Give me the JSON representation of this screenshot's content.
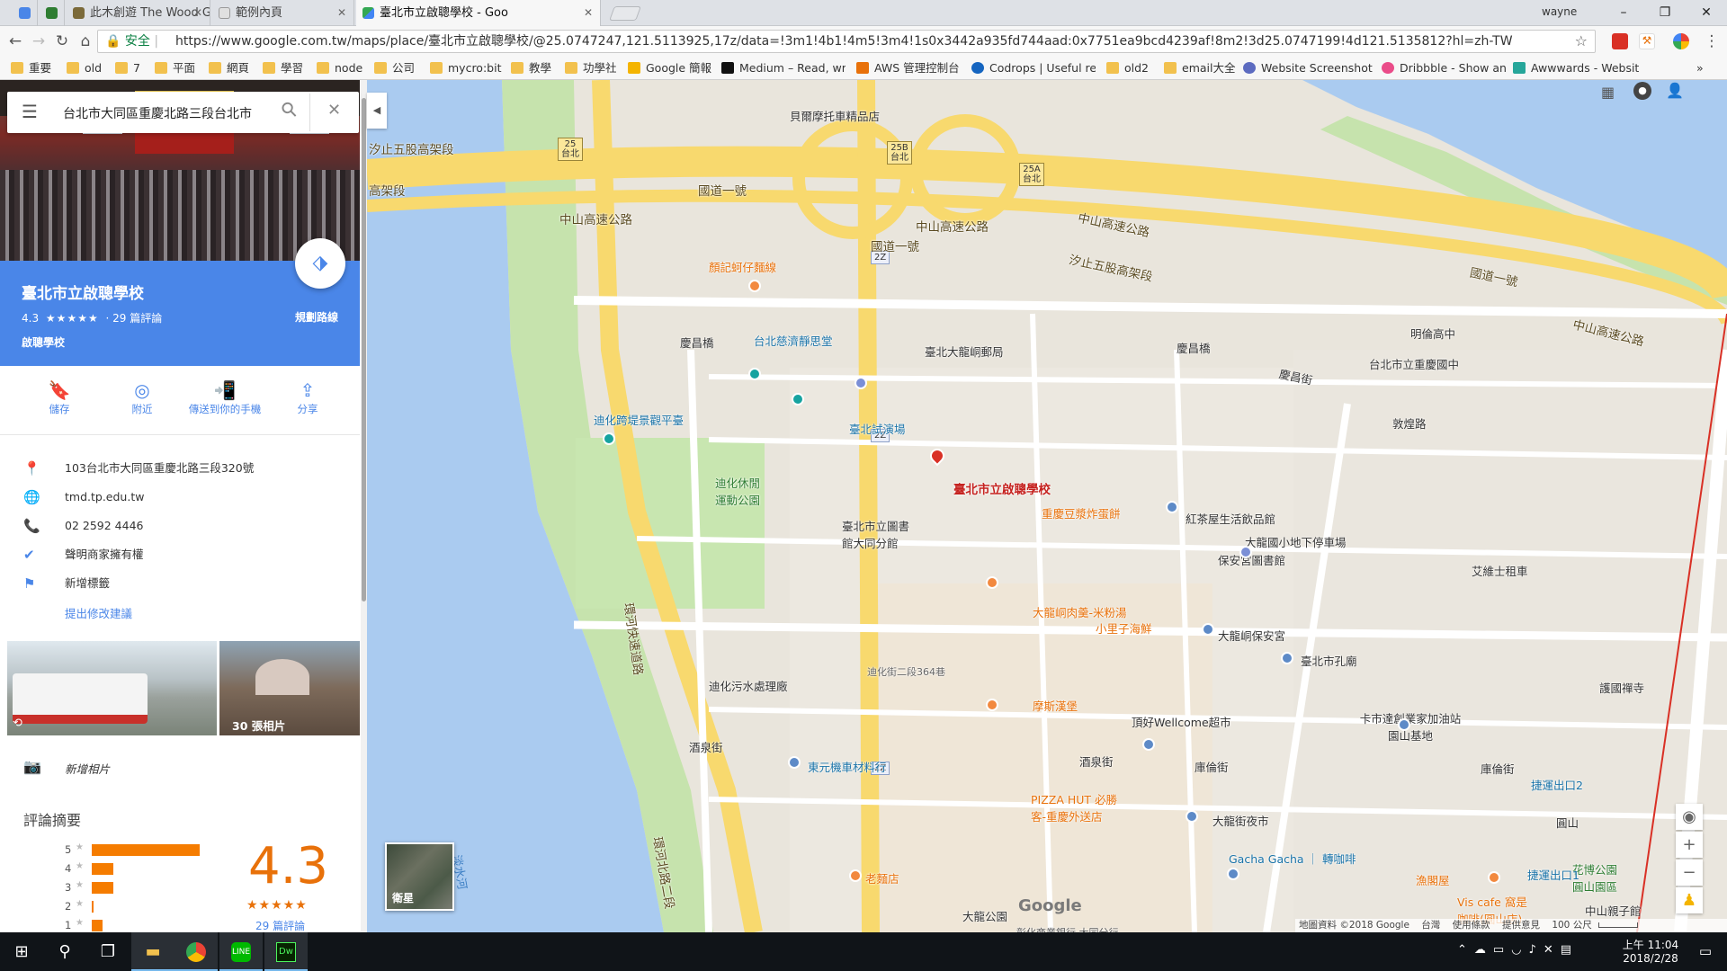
{
  "tabs": [
    {
      "title": "",
      "icon_color": "#4a86e8"
    },
    {
      "title": "",
      "icon_color": "#2e7d32"
    },
    {
      "title": "此木創遊 The Wood Ga",
      "icon_color": "#7b6a3a"
    },
    {
      "title": "範例內頁",
      "icon_color": "#9e9e9e"
    },
    {
      "title": "臺北市立啟聰學校 - Goo",
      "icon_color": "#34a853",
      "active": true
    }
  ],
  "window": {
    "user": "wayne",
    "minimize": "–",
    "maximize": "❐",
    "close": "✕"
  },
  "toolbar": {
    "back": "←",
    "forward": "→",
    "reload": "↻",
    "home": "⌂",
    "secure_label": "安全",
    "url": "https://www.google.com.tw/maps/place/臺北市立啟聰學校/@25.0747247,121.5113925,17z/data=!3m1!4b1!4m5!3m4!1s0x3442a935fd744aad:0x7751ea9bcd4239af!8m2!3d25.0747199!4d121.5135812?hl=zh-TW",
    "bookmark_star": "☆",
    "menu": "⋮"
  },
  "bookmarks": [
    "重要",
    "old",
    "7",
    "平面",
    "網頁",
    "學習",
    "node",
    "公司",
    "mycro:bit",
    "教學",
    "功學社",
    "Google 簡報",
    "Medium – Read, wri",
    "AWS 管理控制台",
    "Codrops | Useful res",
    "old2",
    "email大全",
    "Website Screenshot",
    "Dribbble - Show and",
    "Awwwards - Websit"
  ],
  "bookmarks_more": "»",
  "sidebar": {
    "search_value": "台北市大同區重慶北路三段台北市",
    "menu_icon": "☰",
    "search_icon": "⚲",
    "clear_icon": "✕",
    "place_name": "臺北市立啟聰學校",
    "rating": "4.3",
    "stars": "★★★★★",
    "reviews": "· 29 篇評論",
    "category": "啟聰學校",
    "directions_label": "規劃路線",
    "actions": [
      {
        "label": "儲存",
        "icon": "🔖"
      },
      {
        "label": "附近",
        "icon": "◎"
      },
      {
        "label": "傳送到你的手機",
        "icon": "📲"
      },
      {
        "label": "分享",
        "icon": "⇪"
      }
    ],
    "info": [
      {
        "icon": "📍",
        "text": "103台北市大同區重慶北路三段320號"
      },
      {
        "icon": "🌐",
        "text": "tmd.tp.edu.tw"
      },
      {
        "icon": "📞",
        "text": "02 2592 4446"
      },
      {
        "icon": "✔",
        "text": "聲明商家擁有權"
      },
      {
        "icon": "⚑",
        "text": "新增標籤"
      }
    ],
    "suggest_edit": "提出修改建議",
    "photos_count": "30 張相片",
    "add_photo": "新增相片",
    "review_title": "評論摘要",
    "big_rating": "4.3",
    "big_stars": "★★★★★",
    "review_count": "29 篇評論",
    "rating_bars": [
      {
        "star": "5",
        "fraction": 1.0
      },
      {
        "star": "4",
        "fraction": 0.2
      },
      {
        "star": "3",
        "fraction": 0.2
      },
      {
        "star": "2",
        "fraction": 0.02
      },
      {
        "star": "1",
        "fraction": 0.1
      }
    ]
  },
  "map": {
    "collapse_icon": "◀",
    "place_label": "臺北市立啟聰學校",
    "labels": {
      "l01": "汐止五股高架段",
      "l02": "高架段",
      "l03": "國道一號",
      "l04": "中山高速公路",
      "l05": "中山高速公路",
      "l06": "國道一號",
      "l07": "中山高速公路",
      "l08": "汐止五股高架段",
      "l09": "國道一號",
      "l10": "中山高速公路",
      "l11": "貝爾摩托車精品店",
      "l12": "顏記蚵仔麵線",
      "l13": "台北慈濟靜思堂",
      "l14": "臺北大龍峒郵局",
      "l15": "慶昌橋",
      "l16": "慶昌橋",
      "l17": "慶昌街",
      "l18": "敦煌路",
      "l19": "明倫高中",
      "l20": "台北市立重慶國中",
      "l21": "迪化跨堤景觀平臺",
      "l22": "臺北試演場",
      "l23": "迪化休閒運動公園",
      "l24": "臺北市立圖書館大同分館",
      "l25": "重慶豆漿炸蛋餅",
      "l26": "紅茶屋生活飲品館",
      "l27": "大龍國小地下停車場",
      "l28": "保安宮圖書館",
      "l29": "大龍峒肉羹-米粉湯",
      "l30": "小里子海鮮",
      "l31": "大龍峒保安宮",
      "l32": "臺北市孔廟",
      "l33": "艾維士租車",
      "l34": "迪化污水處理廠",
      "l35": "迪化街二段364巷",
      "l36": "摩斯漢堡",
      "l37": "頂好Wellcome超市",
      "l38": "卡市達創業家加油站園山基地",
      "l39": "酒泉街",
      "l40": "酒泉街",
      "l41": "東元機車材料行",
      "l42": "庫倫街",
      "l43": "庫倫街",
      "l44": "捷運出口2",
      "l45": "PIZZA HUT 必勝客-重慶外送店",
      "l46": "大龍街夜市",
      "l47": "圓山",
      "l48": "Gacha Gacha ｜ 轉咖啡",
      "l49": "老麵店",
      "l50": "漁閣屋",
      "l51": "Vis cafe 窩是咖啡(圓山店)",
      "l52": "花博公園圓山園區",
      "l53": "捷運出口1",
      "l54": "中山親子館",
      "l55": "大龍公園",
      "l56": "彰化商業銀行 大同分行",
      "l57": "環河快速道路",
      "l58": "環河北路二段",
      "l59": "淡水河",
      "l60": "護國禪寺"
    },
    "shields": [
      "25\n台北",
      "25B\n台北",
      "25A\n台北",
      "2Z",
      "2Z",
      "2Z",
      "2Z"
    ],
    "satellite_label": "衛星",
    "footer": [
      "地圖資料 ©2018 Google",
      "台灣",
      "使用條款",
      "提供意見",
      "100 公尺"
    ],
    "google_logo": "Google",
    "zoom_in": "+",
    "zoom_out": "−",
    "locate_icon": "◉"
  },
  "taskbar": {
    "time": "上午 11:04",
    "date": "2018/2/28"
  },
  "colors": {
    "accent": "#4a86e8",
    "highway": "#f8d96e",
    "water": "#a9cdf5",
    "park": "#c8e6b0",
    "star": "#f57c00",
    "pin": "#d93025"
  }
}
